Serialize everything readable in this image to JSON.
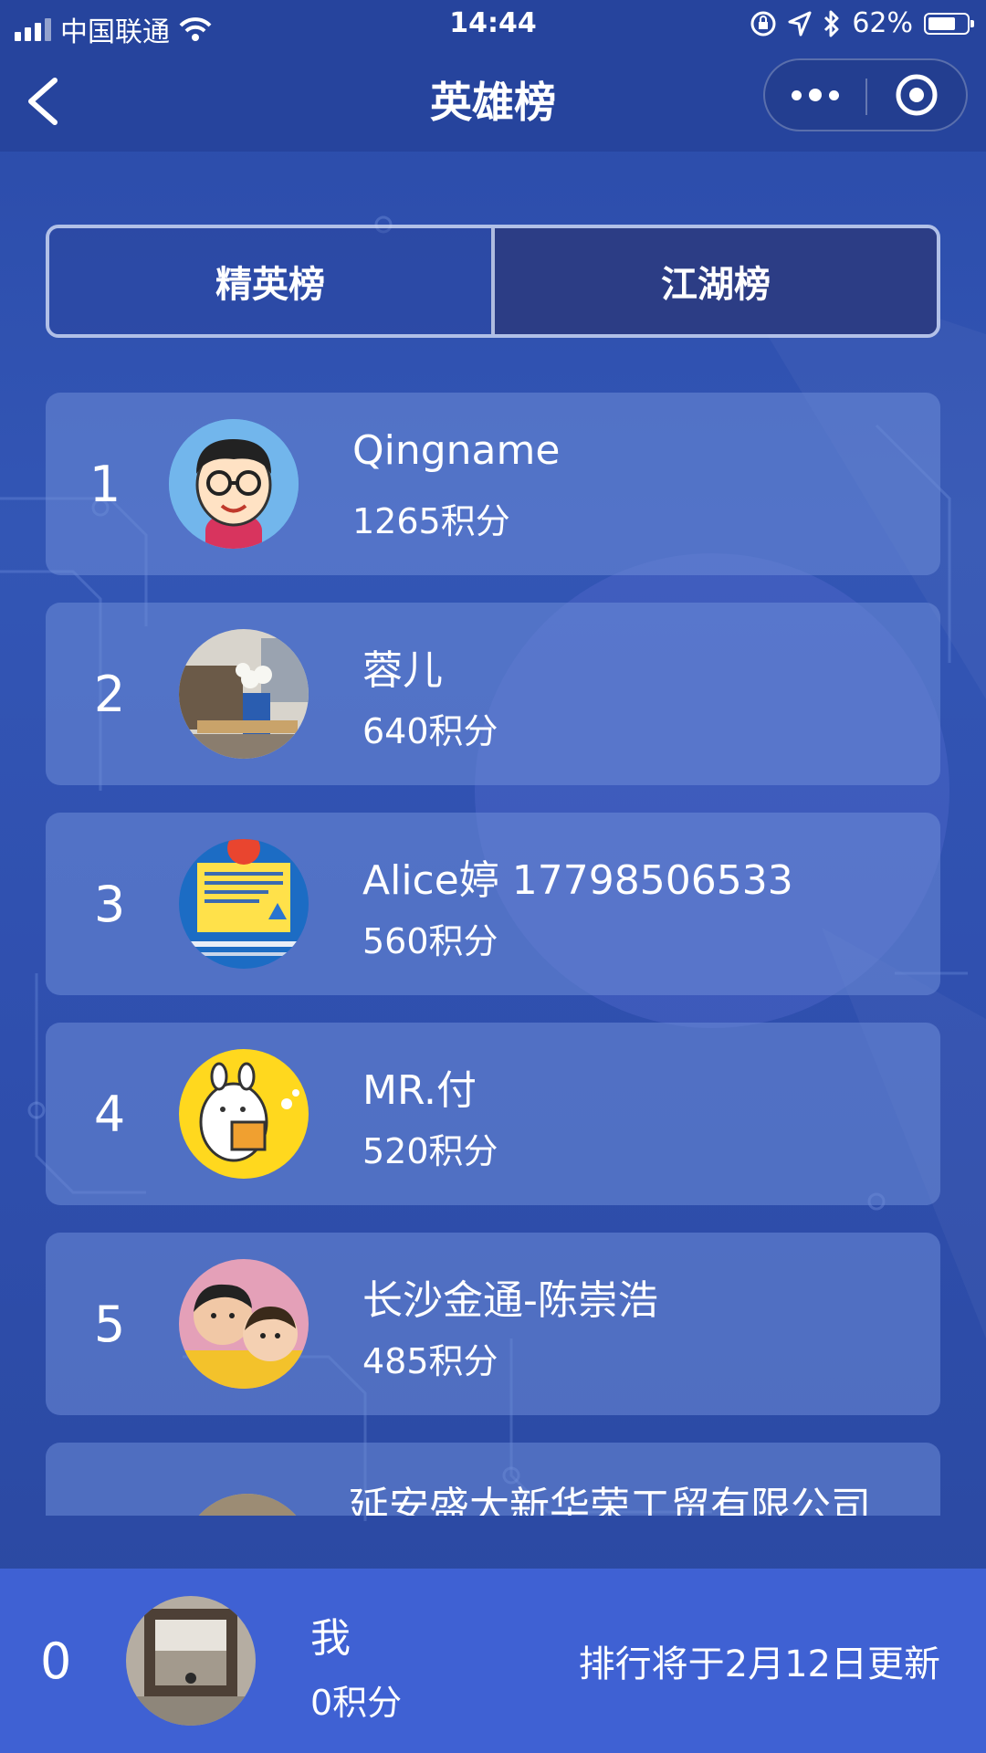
{
  "status_bar": {
    "carrier": "中国联通",
    "time": "14:44",
    "battery_text": "62%"
  },
  "nav": {
    "title": "英雄榜"
  },
  "tabs": [
    {
      "label": "精英榜",
      "active": false
    },
    {
      "label": "江湖榜",
      "active": true
    }
  ],
  "ranking": [
    {
      "rank": "1",
      "name": "Qingname",
      "score": "1265积分",
      "avatar": "cartoon-boy-avatar"
    },
    {
      "rank": "2",
      "name": "蓉儿",
      "score": "640积分",
      "avatar": "flower-vase-photo-avatar"
    },
    {
      "rank": "3",
      "name": "Alice婷 17798506533",
      "score": "560积分",
      "avatar": "notice-poster-avatar"
    },
    {
      "rank": "4",
      "name": "MR.付",
      "score": "520积分",
      "avatar": "cartoon-bunny-avatar"
    },
    {
      "rank": "5",
      "name": "长沙金通-陈崇浩",
      "score": "485积分",
      "avatar": "children-photo-avatar"
    },
    {
      "rank": "",
      "name": "延安盛大新华荣工贸有限公司",
      "score": "",
      "avatar": "photo-avatar"
    }
  ],
  "me": {
    "rank": "0",
    "name": "我",
    "score": "0积分",
    "update_note": "排行将于2月12日更新",
    "avatar": "window-photo-avatar"
  },
  "colors": {
    "nav_bg": "#26449d",
    "page_bg": "#3356b5",
    "card_bg": "#6e8cd7",
    "footer_bg": "#3f61d3",
    "active_tab": "#2c3d85"
  }
}
